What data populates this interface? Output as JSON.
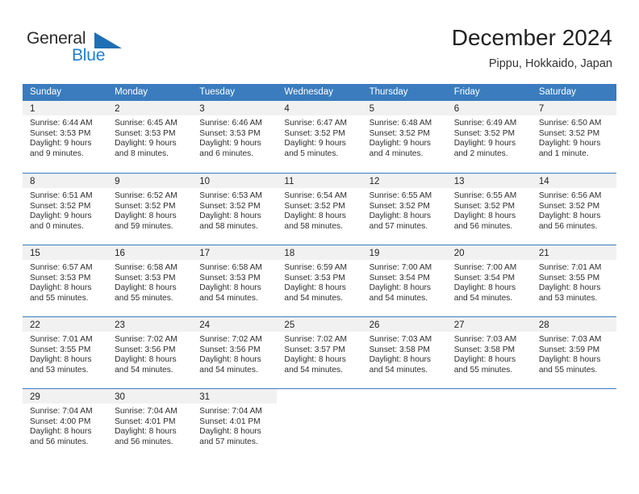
{
  "brand": {
    "name_part1": "General",
    "name_part2": "Blue",
    "logo_icon": "triangle-logo-icon",
    "color_dark": "#2b2b2b",
    "color_blue": "#1f7fd4",
    "triangle_color": "#1f6fb5"
  },
  "header": {
    "title": "December 2024",
    "subtitle": "Pippu, Hokkaido, Japan"
  },
  "theme": {
    "header_bg": "#3a7cbe",
    "header_text": "#ffffff",
    "day_band_bg": "#f1f1f1",
    "cell_bg": "#ffffff",
    "row_divider": "#3a7cbe"
  },
  "calendar": {
    "weekdays": [
      "Sunday",
      "Monday",
      "Tuesday",
      "Wednesday",
      "Thursday",
      "Friday",
      "Saturday"
    ],
    "weeks": [
      [
        {
          "day": "1",
          "sunrise": "Sunrise: 6:44 AM",
          "sunset": "Sunset: 3:53 PM",
          "daylight": "Daylight: 9 hours and 9 minutes."
        },
        {
          "day": "2",
          "sunrise": "Sunrise: 6:45 AM",
          "sunset": "Sunset: 3:53 PM",
          "daylight": "Daylight: 9 hours and 8 minutes."
        },
        {
          "day": "3",
          "sunrise": "Sunrise: 6:46 AM",
          "sunset": "Sunset: 3:53 PM",
          "daylight": "Daylight: 9 hours and 6 minutes."
        },
        {
          "day": "4",
          "sunrise": "Sunrise: 6:47 AM",
          "sunset": "Sunset: 3:52 PM",
          "daylight": "Daylight: 9 hours and 5 minutes."
        },
        {
          "day": "5",
          "sunrise": "Sunrise: 6:48 AM",
          "sunset": "Sunset: 3:52 PM",
          "daylight": "Daylight: 9 hours and 4 minutes."
        },
        {
          "day": "6",
          "sunrise": "Sunrise: 6:49 AM",
          "sunset": "Sunset: 3:52 PM",
          "daylight": "Daylight: 9 hours and 2 minutes."
        },
        {
          "day": "7",
          "sunrise": "Sunrise: 6:50 AM",
          "sunset": "Sunset: 3:52 PM",
          "daylight": "Daylight: 9 hours and 1 minute."
        }
      ],
      [
        {
          "day": "8",
          "sunrise": "Sunrise: 6:51 AM",
          "sunset": "Sunset: 3:52 PM",
          "daylight": "Daylight: 9 hours and 0 minutes."
        },
        {
          "day": "9",
          "sunrise": "Sunrise: 6:52 AM",
          "sunset": "Sunset: 3:52 PM",
          "daylight": "Daylight: 8 hours and 59 minutes."
        },
        {
          "day": "10",
          "sunrise": "Sunrise: 6:53 AM",
          "sunset": "Sunset: 3:52 PM",
          "daylight": "Daylight: 8 hours and 58 minutes."
        },
        {
          "day": "11",
          "sunrise": "Sunrise: 6:54 AM",
          "sunset": "Sunset: 3:52 PM",
          "daylight": "Daylight: 8 hours and 58 minutes."
        },
        {
          "day": "12",
          "sunrise": "Sunrise: 6:55 AM",
          "sunset": "Sunset: 3:52 PM",
          "daylight": "Daylight: 8 hours and 57 minutes."
        },
        {
          "day": "13",
          "sunrise": "Sunrise: 6:55 AM",
          "sunset": "Sunset: 3:52 PM",
          "daylight": "Daylight: 8 hours and 56 minutes."
        },
        {
          "day": "14",
          "sunrise": "Sunrise: 6:56 AM",
          "sunset": "Sunset: 3:52 PM",
          "daylight": "Daylight: 8 hours and 56 minutes."
        }
      ],
      [
        {
          "day": "15",
          "sunrise": "Sunrise: 6:57 AM",
          "sunset": "Sunset: 3:53 PM",
          "daylight": "Daylight: 8 hours and 55 minutes."
        },
        {
          "day": "16",
          "sunrise": "Sunrise: 6:58 AM",
          "sunset": "Sunset: 3:53 PM",
          "daylight": "Daylight: 8 hours and 55 minutes."
        },
        {
          "day": "17",
          "sunrise": "Sunrise: 6:58 AM",
          "sunset": "Sunset: 3:53 PM",
          "daylight": "Daylight: 8 hours and 54 minutes."
        },
        {
          "day": "18",
          "sunrise": "Sunrise: 6:59 AM",
          "sunset": "Sunset: 3:53 PM",
          "daylight": "Daylight: 8 hours and 54 minutes."
        },
        {
          "day": "19",
          "sunrise": "Sunrise: 7:00 AM",
          "sunset": "Sunset: 3:54 PM",
          "daylight": "Daylight: 8 hours and 54 minutes."
        },
        {
          "day": "20",
          "sunrise": "Sunrise: 7:00 AM",
          "sunset": "Sunset: 3:54 PM",
          "daylight": "Daylight: 8 hours and 54 minutes."
        },
        {
          "day": "21",
          "sunrise": "Sunrise: 7:01 AM",
          "sunset": "Sunset: 3:55 PM",
          "daylight": "Daylight: 8 hours and 53 minutes."
        }
      ],
      [
        {
          "day": "22",
          "sunrise": "Sunrise: 7:01 AM",
          "sunset": "Sunset: 3:55 PM",
          "daylight": "Daylight: 8 hours and 53 minutes."
        },
        {
          "day": "23",
          "sunrise": "Sunrise: 7:02 AM",
          "sunset": "Sunset: 3:56 PM",
          "daylight": "Daylight: 8 hours and 54 minutes."
        },
        {
          "day": "24",
          "sunrise": "Sunrise: 7:02 AM",
          "sunset": "Sunset: 3:56 PM",
          "daylight": "Daylight: 8 hours and 54 minutes."
        },
        {
          "day": "25",
          "sunrise": "Sunrise: 7:02 AM",
          "sunset": "Sunset: 3:57 PM",
          "daylight": "Daylight: 8 hours and 54 minutes."
        },
        {
          "day": "26",
          "sunrise": "Sunrise: 7:03 AM",
          "sunset": "Sunset: 3:58 PM",
          "daylight": "Daylight: 8 hours and 54 minutes."
        },
        {
          "day": "27",
          "sunrise": "Sunrise: 7:03 AM",
          "sunset": "Sunset: 3:58 PM",
          "daylight": "Daylight: 8 hours and 55 minutes."
        },
        {
          "day": "28",
          "sunrise": "Sunrise: 7:03 AM",
          "sunset": "Sunset: 3:59 PM",
          "daylight": "Daylight: 8 hours and 55 minutes."
        }
      ],
      [
        {
          "day": "29",
          "sunrise": "Sunrise: 7:04 AM",
          "sunset": "Sunset: 4:00 PM",
          "daylight": "Daylight: 8 hours and 56 minutes."
        },
        {
          "day": "30",
          "sunrise": "Sunrise: 7:04 AM",
          "sunset": "Sunset: 4:01 PM",
          "daylight": "Daylight: 8 hours and 56 minutes."
        },
        {
          "day": "31",
          "sunrise": "Sunrise: 7:04 AM",
          "sunset": "Sunset: 4:01 PM",
          "daylight": "Daylight: 8 hours and 57 minutes."
        },
        {
          "day": "",
          "sunrise": "",
          "sunset": "",
          "daylight": ""
        },
        {
          "day": "",
          "sunrise": "",
          "sunset": "",
          "daylight": ""
        },
        {
          "day": "",
          "sunrise": "",
          "sunset": "",
          "daylight": ""
        },
        {
          "day": "",
          "sunrise": "",
          "sunset": "",
          "daylight": ""
        }
      ]
    ]
  }
}
